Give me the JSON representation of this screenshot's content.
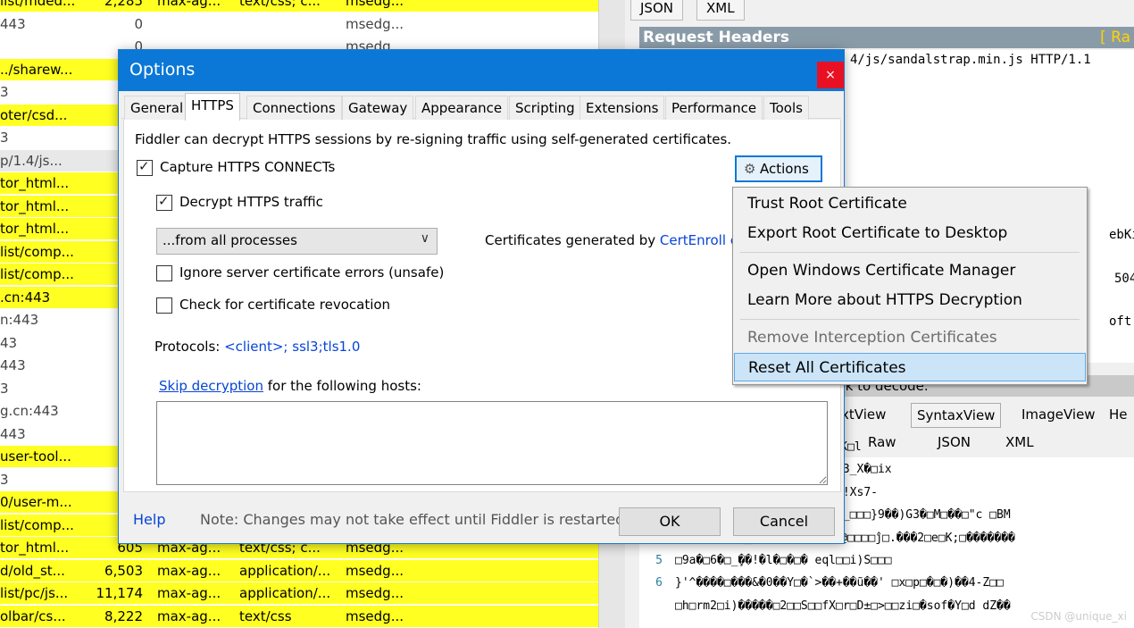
{
  "sessions": [
    {
      "url": "list/mded...",
      "body": "2,285",
      "cache": "max-ag...",
      "ctype": "text/css; c...",
      "proc": "msedg...",
      "hl": true
    },
    {
      "url": "443",
      "body": "0",
      "cache": "",
      "ctype": "",
      "proc": "msedg...",
      "hl": false
    },
    {
      "url": "",
      "body": "0",
      "cache": "",
      "ctype": "",
      "proc": "msedg...",
      "hl": false
    },
    {
      "url": "../sharew...",
      "body": "",
      "cache": "",
      "ctype": "",
      "proc": "",
      "hl": true
    },
    {
      "url": "3",
      "body": "",
      "cache": "",
      "ctype": "",
      "proc": "",
      "hl": false
    },
    {
      "url": "oter/csd...",
      "body": "2,",
      "cache": "",
      "ctype": "",
      "proc": "",
      "hl": true
    },
    {
      "url": "3",
      "body": "",
      "cache": "",
      "ctype": "",
      "proc": "",
      "hl": false
    },
    {
      "url": "p/1.4/js...",
      "body": "1,",
      "cache": "",
      "ctype": "",
      "proc": "",
      "hl": false,
      "gray": true
    },
    {
      "url": "tor_html...",
      "body": "",
      "cache": "",
      "ctype": "",
      "proc": "",
      "hl": true
    },
    {
      "url": "tor_html...",
      "body": "13,",
      "cache": "",
      "ctype": "",
      "proc": "",
      "hl": true
    },
    {
      "url": "tor_html...",
      "body": "",
      "cache": "",
      "ctype": "",
      "proc": "",
      "hl": true
    },
    {
      "url": "list/comp...",
      "body": "45,",
      "cache": "",
      "ctype": "",
      "proc": "",
      "hl": true
    },
    {
      "url": "list/comp...",
      "body": "2,",
      "cache": "",
      "ctype": "",
      "proc": "",
      "hl": true
    },
    {
      "url": ".cn:443",
      "body": "",
      "cache": "",
      "ctype": "",
      "proc": "",
      "hl": true
    },
    {
      "url": "n:443",
      "body": "",
      "cache": "",
      "ctype": "",
      "proc": "",
      "hl": false
    },
    {
      "url": "43",
      "body": "",
      "cache": "",
      "ctype": "",
      "proc": "",
      "hl": false
    },
    {
      "url": "443",
      "body": "",
      "cache": "",
      "ctype": "",
      "proc": "",
      "hl": false
    },
    {
      "url": "3",
      "body": "",
      "cache": "",
      "ctype": "",
      "proc": "",
      "hl": false
    },
    {
      "url": "g.cn:443",
      "body": "",
      "cache": "",
      "ctype": "",
      "proc": "",
      "hl": false
    },
    {
      "url": "443",
      "body": "",
      "cache": "",
      "ctype": "",
      "proc": "",
      "hl": false
    },
    {
      "url": "user-tool...",
      "body": "3,",
      "cache": "",
      "ctype": "",
      "proc": "",
      "hl": true
    },
    {
      "url": "3",
      "body": "",
      "cache": "",
      "ctype": "",
      "proc": "",
      "hl": false
    },
    {
      "url": "0/user-m...",
      "body": "5,",
      "cache": "",
      "ctype": "",
      "proc": "",
      "hl": true
    },
    {
      "url": "list/comp...",
      "body": "2,",
      "cache": "",
      "ctype": "",
      "proc": "",
      "hl": true
    },
    {
      "url": "tor_html...",
      "body": "605",
      "cache": "max-ag...",
      "ctype": "text/css; c...",
      "proc": "msedg...",
      "hl": true
    },
    {
      "url": "d/old_st...",
      "body": "6,503",
      "cache": "max-ag...",
      "ctype": "application/...",
      "proc": "msedg...",
      "hl": true
    },
    {
      "url": "list/pc/js...",
      "body": "11,174",
      "cache": "max-ag...",
      "ctype": "application/...",
      "proc": "msedg...",
      "hl": true
    },
    {
      "url": "olbar/cs...",
      "body": "8,222",
      "cache": "max-ag...",
      "ctype": "text/css",
      "proc": "msedg...",
      "hl": true
    }
  ],
  "inspector": {
    "top_tabs": [
      "JSON",
      "XML"
    ],
    "request_headers_title": "Request Headers",
    "raw_link": "[ Ra",
    "request_line": "4/js/sandalstrap.min.js HTTP/1.1",
    "fragments": [
      "ebKit/53",
      "5047?u",
      "oft Edge"
    ],
    "encoded_bar": "esponse body is encoded. Click to decode.",
    "response_tabs_row1": [
      "xtView",
      "SyntaxView",
      "ImageView",
      "He"
    ],
    "response_tabs_row2": [
      "Raw",
      "JSON",
      "XML"
    ],
    "code_lines": [
      {
        "ln": "",
        "code": "+□�a□□□-□3□-Ü4□=8i□顎:□�K□l"
      },
      {
        "ln": "",
        "code": "̧o□□rJ*□A□4dD□�<□�G_□��> 3_X�□ix"
      },
      {
        "ln": "",
        "code": "A^□□+□□g/□r□��J=□�□x□k□□!Xs7-"
      },
      {
        "ln": "",
        "code": "p��8��f0�8��□B��8>□□�q89_□□□}9��)G3�□M□��□\"c □BM"
      },
      {
        "ln": "4",
        "code": "□It[□□40`#_H□ò□V�□�侈] D@□□□□ĵ□.���2□e□K;□�������"
      },
      {
        "ln": "5",
        "code": "□9a�□6�□_̧��!�l�□�□� eql□□i)S□□□"
      },
      {
        "ln": "6",
        "code": "}'^����□���&�0��Y□�`>��+��ũ��'  □x□p□�□�)��4-Z□□"
      },
      {
        "ln": "",
        "code": "□h□rm2□i)�����□2□□S□□fX□r□D±□>□□zi□�sof�Y□d dZ��"
      }
    ],
    "watermark": "CSDN @unique_xi"
  },
  "dialog": {
    "title": "Options",
    "close_glyph": "×",
    "tabs": [
      "General",
      "HTTPS",
      "Connections",
      "Gateway",
      "Appearance",
      "Scripting",
      "Extensions",
      "Performance",
      "Tools"
    ],
    "active_tab": "HTTPS",
    "intro": "Fiddler can decrypt HTTPS sessions by re-signing traffic using self-generated certificates.",
    "capture_label": "Capture HTTPS CONNECTs",
    "decrypt_label": "Decrypt HTTPS traffic",
    "process_filter": "...from all processes",
    "cert_gen_prefix": "Certificates generated by ",
    "cert_gen_link": "CertEnroll e",
    "ignore_errors_label": "Ignore server certificate errors (unsafe)",
    "revocation_label": "Check for certificate revocation",
    "protocols_prefix": "Protocols: ",
    "protocols_value": "<client>; ssl3;tls1.0",
    "skip_link": "Skip decryption",
    "skip_suffix": " for the following hosts:",
    "skip_hosts": "",
    "actions_label": "Actions",
    "help_label": "Help",
    "note": "Note: Changes may not take effect until Fiddler is restarted.",
    "ok_label": "OK",
    "cancel_label": "Cancel"
  },
  "actions_menu": [
    {
      "label": "Trust Root Certificate",
      "enabled": true
    },
    {
      "label": "Export Root Certificate to Desktop",
      "enabled": true
    },
    {
      "label": "Open Windows Certificate Manager",
      "enabled": true
    },
    {
      "label": "Learn More about HTTPS Decryption",
      "enabled": true
    },
    {
      "label": "Remove Interception Certificates",
      "enabled": false
    },
    {
      "label": "Reset All Certificates",
      "enabled": true,
      "hovered": true
    }
  ],
  "colors": {
    "highlight": "#ffff22",
    "title_bar": "#0b78d7",
    "close": "#e81123",
    "link": "#0645d8"
  }
}
